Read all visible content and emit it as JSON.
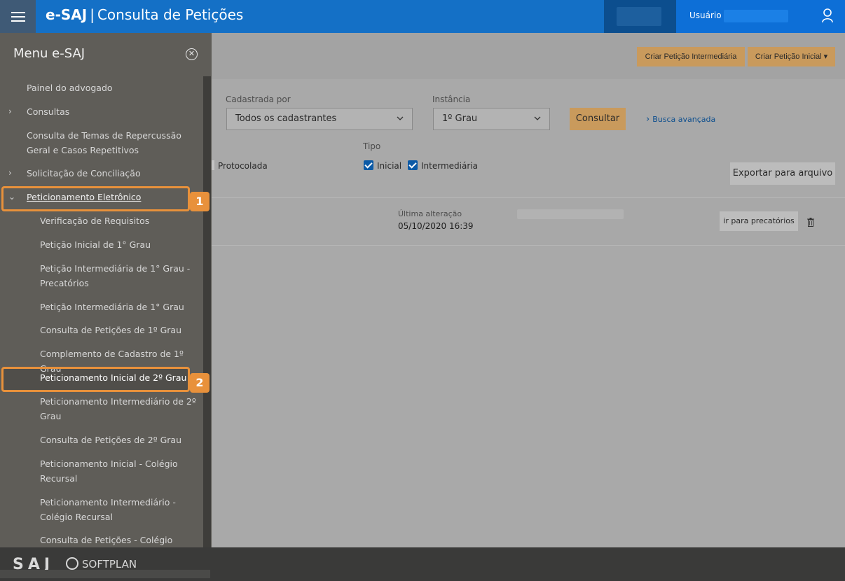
{
  "header": {
    "brand": "e-SAJ",
    "separator": "|",
    "title": "Consulta de Petições",
    "user_label": "Usuário",
    "menu_icon": "hamburger-icon",
    "user_icon": "user-icon"
  },
  "sidebar": {
    "title": "Menu e-SAJ",
    "close_icon": "close-circle-icon",
    "items": [
      {
        "label": "Painel do advogado",
        "level": 1,
        "arrow": ""
      },
      {
        "label": "Consultas",
        "level": 1,
        "arrow": "›"
      },
      {
        "label": "Consulta de Temas de Repercussão Geral e Casos Repetitivos",
        "level": 1,
        "arrow": ""
      },
      {
        "label": "Solicitação de Conciliação",
        "level": 1,
        "arrow": "›"
      },
      {
        "label": "Peticionamento Eletrônico",
        "level": 1,
        "arrow": "⌄"
      },
      {
        "label": "Verificação de Requisitos",
        "level": 2
      },
      {
        "label": "Petição Inicial de 1° Grau",
        "level": 2
      },
      {
        "label": "Petição Intermediária de 1° Grau - Precatórios",
        "level": 2
      },
      {
        "label": "Petição Intermediária de 1° Grau",
        "level": 2
      },
      {
        "label": "Consulta de Petições de 1º Grau",
        "level": 2
      },
      {
        "label": "Complemento de Cadastro de 1º Grau",
        "level": 2
      },
      {
        "label": "Peticionamento Inicial de 2º Grau",
        "level": 2
      },
      {
        "label": "Peticionamento Intermediário de 2º Grau",
        "level": 2
      },
      {
        "label": "Consulta de Petições de 2º Grau",
        "level": 2
      },
      {
        "label": "Peticionamento Inicial - Colégio Recursal",
        "level": 2
      },
      {
        "label": "Peticionamento Intermediário - Colégio Recursal",
        "level": 2
      },
      {
        "label": "Consulta de Petições - Colégio",
        "level": 2
      }
    ],
    "badges": [
      "1",
      "2"
    ],
    "highlight_color": "#e8913b"
  },
  "footer": {
    "saj_logo": "SAJ",
    "softplan": "SOFTPLAN"
  },
  "toolbar": {
    "criar_intermediaria": "Criar Petição Intermediária",
    "criar_inicial": "Criar Petição Inicial ▾"
  },
  "filters": {
    "cadastrada_label": "Cadastrada por",
    "cadastrada_value": "Todos os cadastrantes",
    "instancia_label": "Instância",
    "instancia_value": "1º Grau",
    "consultar": "Consultar",
    "busca_avancada": "Busca avançada",
    "busca_arrow": "›",
    "protocolada": "Protocolada",
    "tipo_label": "Tipo",
    "tipo_inicial": "Inicial",
    "tipo_intermediaria": "Intermediária",
    "exportar": "Exportar para arquivo"
  },
  "result": {
    "ultima_label": "Última alteração",
    "ultima_value": "05/10/2020 16:39",
    "precatorios_button": "ir para precatórios",
    "trash_icon": "trash-icon"
  },
  "colors": {
    "header_blue": "#1470c6",
    "accent_orange": "#c99a5c",
    "sidebar_bg": "#5f5d58"
  }
}
